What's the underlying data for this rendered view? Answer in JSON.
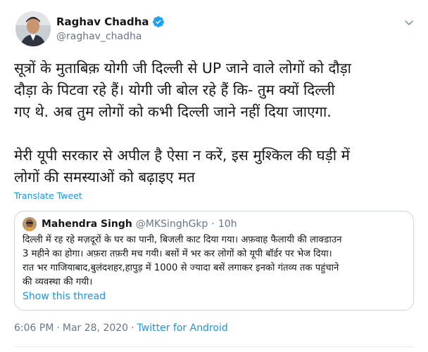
{
  "author": {
    "name": "Raghav Chadha",
    "handle": "@raghav_chadha",
    "verified_icon": "verified-badge-icon"
  },
  "tweet_text": "सूत्रों के मुताबिक़ योगी जी दिल्ली से UP जाने वाले लोगों को दौड़ा\nदौड़ा के पिटवा रहे हैं। योगी जी बोल रहे हैं कि- तुम क्यों दिल्ली\nगए थे. अब तुम लोगों को कभी दिल्ली जाने नहीं दिया जाएगा.\n\nमेरी यूपी सरकार से अपील है ऐसा न करें, इस मुश्किल की घड़ी में\nलोगों की समस्याओं को बढ़ाइए मत",
  "translate_label": "Translate Tweet",
  "quoted_tweet": {
    "name": "Mahendra Singh",
    "handle": "@MKSinghGkp",
    "dot": "·",
    "age": "10h",
    "text": "दिल्ली में रह रहे मज़दूरों के घर का पानी, बिजली काट दिया गया। अफ़वाह फैलायी की लाक्डाउन\n3 महीने का होगा। अफ़रा तफ़री मच गयी। बसों में भर कर लोगों को यूपी बॉर्डर पर भेज दिया।\nरात भर गाजियाबाद,बुलंदशहर,हापुड़ में 1000 से ज्यादा बसें लगाकर इनको गंतव्य तक पहुंचाने\nकी व्यवस्था की गयी।",
    "show_thread": "Show this thread"
  },
  "meta": {
    "time": "6:06 PM",
    "sep1": "·",
    "date": "Mar 28, 2020",
    "sep2": "·",
    "source": "Twitter for Android"
  },
  "colors": {
    "link": "#1b95e0",
    "secondary_text": "#657786",
    "border": "#ccd6dd",
    "verified": "#1da1f2"
  }
}
